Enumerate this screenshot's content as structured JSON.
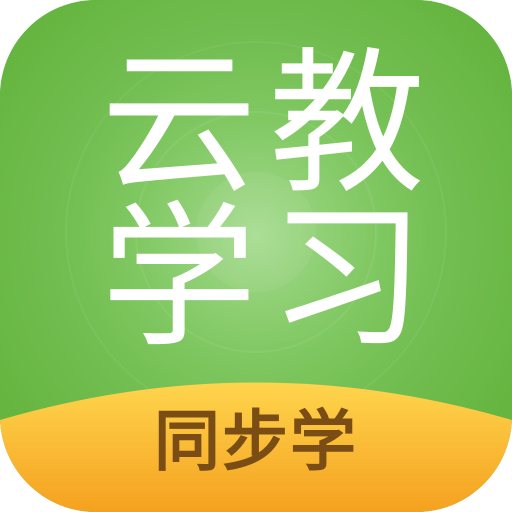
{
  "app_icon": {
    "title_chars": [
      "云",
      "教",
      "学",
      "习"
    ],
    "banner_text": "同步学",
    "colors": {
      "background": "#69b844",
      "glow_center": "#a3d98c",
      "text": "#ffffff",
      "banner_light": "#ffd24a",
      "banner_dark": "#f6a623",
      "banner_text": "#7a4d14"
    }
  }
}
